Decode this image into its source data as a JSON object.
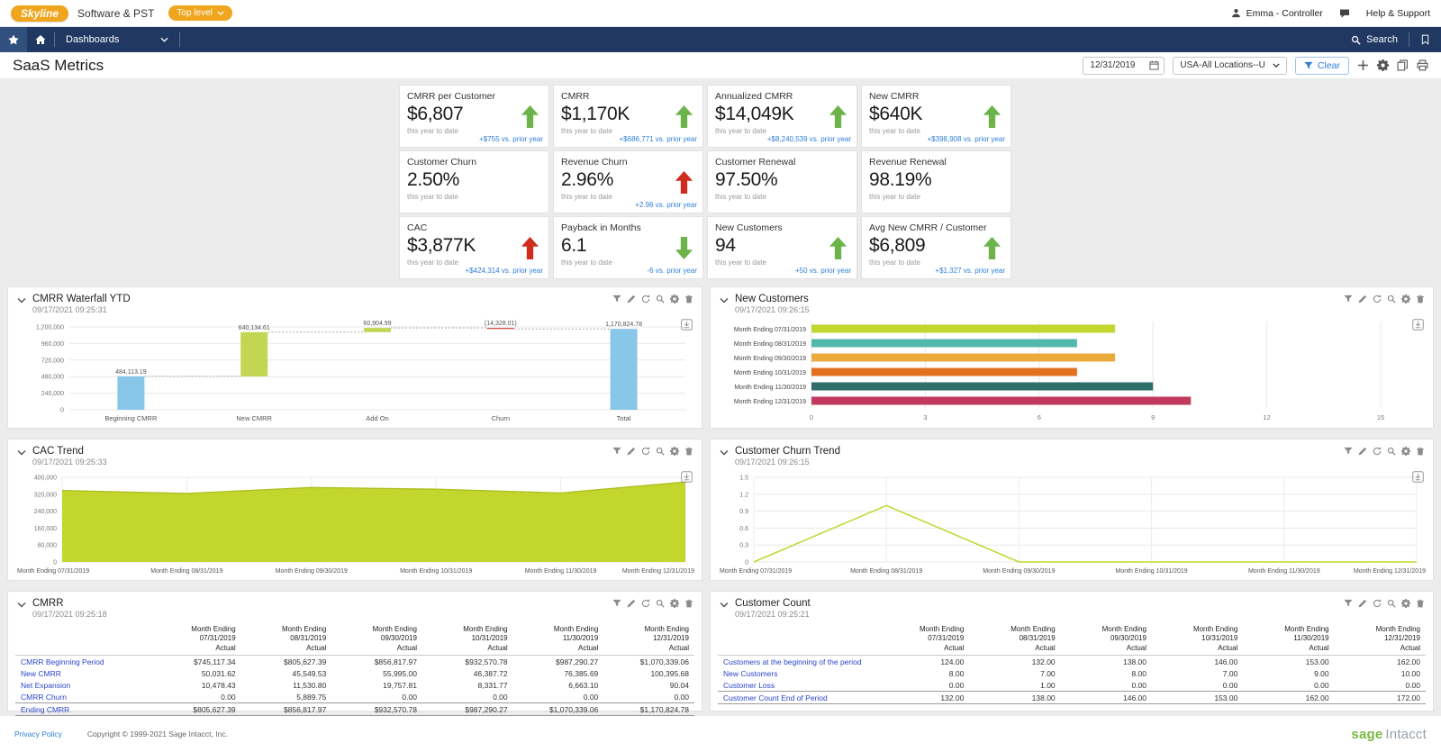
{
  "header": {
    "brand": "Skyline",
    "product": "Software & PST",
    "entity": "Top level",
    "user": "Emma - Controller",
    "help": "Help & Support"
  },
  "nav": {
    "dashboards": "Dashboards",
    "search": "Search"
  },
  "page": {
    "title": "SaaS Metrics"
  },
  "toolbar": {
    "date_value": "12/31/2019",
    "location_value": "USA-All Locations--U",
    "clear": "Clear"
  },
  "kpis": [
    {
      "title": "CMRR per Customer",
      "value": "$6,807",
      "period": "this year to date",
      "delta": "+$755 vs. prior year",
      "arrow": "up",
      "arrow_color": "green"
    },
    {
      "title": "CMRR",
      "value": "$1,170K",
      "period": "this year to date",
      "delta": "+$686,771 vs. prior year",
      "arrow": "up",
      "arrow_color": "green"
    },
    {
      "title": "Annualized CMRR",
      "value": "$14,049K",
      "period": "this year to date",
      "delta": "+$8,240,539 vs. prior year",
      "arrow": "up",
      "arrow_color": "green"
    },
    {
      "title": "New CMRR",
      "value": "$640K",
      "period": "this year to date",
      "delta": "+$398,908 vs. prior year",
      "arrow": "up",
      "arrow_color": "green"
    },
    {
      "title": "Customer Churn",
      "value": "2.50%",
      "period": "this year to date",
      "delta": "",
      "arrow": "none",
      "arrow_color": ""
    },
    {
      "title": "Revenue Churn",
      "value": "2.96%",
      "period": "this year to date",
      "delta": "+2.96 vs. prior year",
      "arrow": "up",
      "arrow_color": "red"
    },
    {
      "title": "Customer Renewal",
      "value": "97.50%",
      "period": "this year to date",
      "delta": "",
      "arrow": "none",
      "arrow_color": ""
    },
    {
      "title": "Revenue Renewal",
      "value": "98.19%",
      "period": "this year to date",
      "delta": "",
      "arrow": "none",
      "arrow_color": ""
    },
    {
      "title": "CAC",
      "value": "$3,877K",
      "period": "this year to date",
      "delta": "+$424,314 vs. prior year",
      "arrow": "up",
      "arrow_color": "red"
    },
    {
      "title": "Payback in Months",
      "value": "6.1",
      "period": "this year to date",
      "delta": "-6 vs. prior year",
      "arrow": "down",
      "arrow_color": "green"
    },
    {
      "title": "New Customers",
      "value": "94",
      "period": "this year to date",
      "delta": "+50 vs. prior year",
      "arrow": "up",
      "arrow_color": "green"
    },
    {
      "title": "Avg New CMRR / Customer",
      "value": "$6,809",
      "period": "this year to date",
      "delta": "+$1,327 vs. prior year",
      "arrow": "up",
      "arrow_color": "green"
    }
  ],
  "panels": [
    {
      "title": "CMRR Waterfall YTD",
      "timestamp": "09/17/2021 09:25:31"
    },
    {
      "title": "New Customers",
      "timestamp": "09/17/2021 09:26:15"
    },
    {
      "title": "CAC Trend",
      "timestamp": "09/17/2021 09:25:33"
    },
    {
      "title": "Customer Churn Trend",
      "timestamp": "09/17/2021 09:26:15"
    },
    {
      "title": "CMRR",
      "timestamp": "09/17/2021 09:25:18"
    },
    {
      "title": "Customer Count",
      "timestamp": "09/17/2021 09:25:21"
    }
  ],
  "chart_data": [
    {
      "id": "waterfall",
      "type": "bar",
      "subtype": "waterfall",
      "title": "CMRR Waterfall YTD",
      "categories": [
        "Beginning CMRR",
        "New CMRR",
        "Add On",
        "Churn",
        "Total"
      ],
      "values": [
        484113.19,
        640134.61,
        60904.99,
        -14328.01,
        1170824.78
      ],
      "labels": [
        "484,113.19",
        "640,134.61",
        "60,904.99",
        "(14,328.01)",
        "1,170,824.78"
      ],
      "bar_colors": [
        "#88c7e9",
        "#c3d654",
        "#c3d654",
        "#cc4437",
        "#88c7e9"
      ],
      "ylim": [
        0,
        1200000
      ],
      "ytick_step": 240000,
      "ytick_labels": [
        "0",
        "240,000",
        "480,000",
        "720,000",
        "960,000",
        "1,200,000"
      ],
      "grid": true,
      "legend": "none"
    },
    {
      "id": "new_customers",
      "type": "bar",
      "orientation": "horizontal",
      "title": "New Customers",
      "categories": [
        "Month Ending 07/31/2019",
        "Month Ending 08/31/2019",
        "Month Ending 09/30/2019",
        "Month Ending 10/31/2019",
        "Month Ending 11/30/2019",
        "Month Ending 12/31/2019"
      ],
      "values": [
        8,
        7,
        8,
        7,
        9,
        10
      ],
      "bar_colors": [
        "#c3d62e",
        "#52b8ac",
        "#eaaa3c",
        "#e2701f",
        "#2e6f6c",
        "#c13a5e"
      ],
      "xlim": [
        0,
        15
      ],
      "xticks": [
        0,
        3,
        6,
        9,
        12,
        15
      ],
      "grid": true,
      "legend": "none"
    },
    {
      "id": "cac_trend",
      "type": "area",
      "title": "CAC Trend",
      "x": [
        "Month Ending 07/31/2019",
        "Month Ending 08/31/2019",
        "Month Ending 09/30/2019",
        "Month Ending 10/31/2019",
        "Month Ending 11/30/2019",
        "Month Ending 12/31/2019"
      ],
      "values": [
        338000,
        324000,
        352000,
        344000,
        326000,
        378000
      ],
      "color": "#c3d62e",
      "line_color": "#aebe1e",
      "ylim": [
        0,
        400000
      ],
      "ytick_step": 80000,
      "ytick_labels": [
        "0",
        "80,000",
        "160,000",
        "240,000",
        "320,000",
        "400,000"
      ],
      "grid": true,
      "legend": "none"
    },
    {
      "id": "customer_churn_trend",
      "type": "line",
      "title": "Customer Churn Trend",
      "x": [
        "Month Ending 07/31/2019",
        "Month Ending 08/31/2019",
        "Month Ending 09/30/2019",
        "Month Ending 10/31/2019",
        "Month Ending 11/30/2019",
        "Month Ending 12/31/2019"
      ],
      "values": [
        0,
        1.0,
        0,
        0,
        0,
        0
      ],
      "color": "#c3d62e",
      "ylim": [
        0,
        1.5
      ],
      "ytick_step": 0.3,
      "ytick_labels": [
        "0",
        "0.3",
        "0.6",
        "0.9",
        "1.2",
        "1.5"
      ],
      "grid": true,
      "legend": "none"
    }
  ],
  "tables": {
    "cmrr": {
      "columns": [
        {
          "l1": "Month Ending",
          "l2": "07/31/2019",
          "l3": "Actual"
        },
        {
          "l1": "Month Ending",
          "l2": "08/31/2019",
          "l3": "Actual"
        },
        {
          "l1": "Month Ending",
          "l2": "09/30/2019",
          "l3": "Actual"
        },
        {
          "l1": "Month Ending",
          "l2": "10/31/2019",
          "l3": "Actual"
        },
        {
          "l1": "Month Ending",
          "l2": "11/30/2019",
          "l3": "Actual"
        },
        {
          "l1": "Month Ending",
          "l2": "12/31/2019",
          "l3": "Actual"
        }
      ],
      "rows": [
        {
          "label": "CMRR Beginning Period",
          "values": [
            "$745,117.34",
            "$805,627.39",
            "$856,817.97",
            "$932,570.78",
            "$987,290.27",
            "$1,070,339.06"
          ],
          "total": false
        },
        {
          "label": "New CMRR",
          "values": [
            "50,031.62",
            "45,549.53",
            "55,995.00",
            "46,387.72",
            "76,385.69",
            "100,395.68"
          ],
          "total": false
        },
        {
          "label": "Net Expansion",
          "values": [
            "10,478.43",
            "11,530.80",
            "19,757.81",
            "8,331.77",
            "6,663.10",
            "90.04"
          ],
          "total": false
        },
        {
          "label": "CMRR Churn",
          "values": [
            "0.00",
            "5,889.75",
            "0.00",
            "0.00",
            "0.00",
            "0.00"
          ],
          "total": false
        },
        {
          "label": "Ending CMRR",
          "values": [
            "$805,627.39",
            "$856,817.97",
            "$932,570.78",
            "$987,290.27",
            "$1,070,339.06",
            "$1,170,824.78"
          ],
          "total": true
        }
      ]
    },
    "customer_count": {
      "columns": [
        {
          "l1": "Month Ending",
          "l2": "07/31/2019",
          "l3": "Actual"
        },
        {
          "l1": "Month Ending",
          "l2": "08/31/2019",
          "l3": "Actual"
        },
        {
          "l1": "Month Ending",
          "l2": "09/30/2019",
          "l3": "Actual"
        },
        {
          "l1": "Month Ending",
          "l2": "10/31/2019",
          "l3": "Actual"
        },
        {
          "l1": "Month Ending",
          "l2": "11/30/2019",
          "l3": "Actual"
        },
        {
          "l1": "Month Ending",
          "l2": "12/31/2019",
          "l3": "Actual"
        }
      ],
      "rows": [
        {
          "label": "Customers at the beginning of the period",
          "values": [
            "124.00",
            "132.00",
            "138.00",
            "146.00",
            "153.00",
            "162.00"
          ],
          "total": false
        },
        {
          "label": "New Customers",
          "values": [
            "8.00",
            "7.00",
            "8.00",
            "7.00",
            "9.00",
            "10.00"
          ],
          "total": false
        },
        {
          "label": "Customer Loss",
          "values": [
            "0.00",
            "1.00",
            "0.00",
            "0.00",
            "0.00",
            "0.00"
          ],
          "total": false
        },
        {
          "label": "Customer Count End of Period",
          "values": [
            "132.00",
            "138.00",
            "146.00",
            "153.00",
            "162.00",
            "172.00"
          ],
          "total": true
        }
      ]
    }
  },
  "footer": {
    "privacy": "Privacy Policy",
    "copyright": "Copyright © 1999-2021 Sage Intacct, Inc.",
    "logo_sage": "sage",
    "logo_intacct": "Intacct"
  }
}
